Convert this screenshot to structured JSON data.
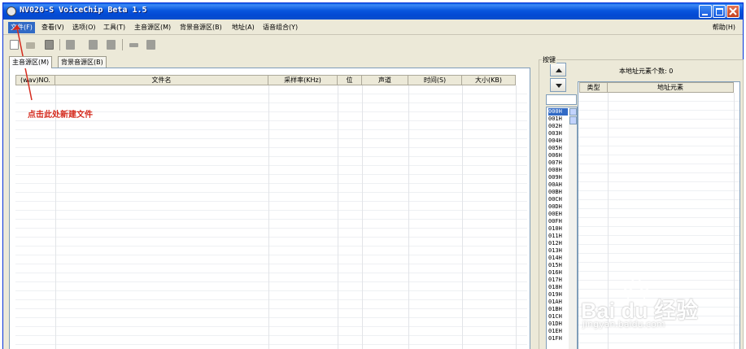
{
  "window": {
    "title": "NV020-S VoiceChip Beta 1.5"
  },
  "menu": {
    "items": [
      "文件(F)",
      "查看(V)",
      "选项(O)",
      "工具(T)",
      "主音源区(M)",
      "背景音源区(B)",
      "地址(A)",
      "语音组合(Y)"
    ],
    "help": "帮助(H)"
  },
  "toolbar": {
    "icons": [
      "new-file-icon",
      "open-folder-icon",
      "save-disk-icon",
      "tool-binoculars-icon",
      "convert-icon",
      "convert-all-icon",
      "connect-icon",
      "play-icon"
    ]
  },
  "tabs": {
    "main": "主音源区(M)",
    "background": "背景音源区(B)"
  },
  "table": {
    "headers": [
      "(wav)NO.",
      "文件名",
      "采样率(KHz)",
      "位",
      "声道",
      "时间(S)",
      "大小(KB)"
    ]
  },
  "annotation": {
    "text": "点击此处新建文件",
    "color": "#d52b1e"
  },
  "keys_panel": {
    "label": "按键",
    "count_label": "本地址元素个数: 0",
    "element_headers": [
      "类型",
      "地址元素"
    ],
    "addresses": [
      "000H",
      "001H",
      "002H",
      "003H",
      "004H",
      "005H",
      "006H",
      "007H",
      "008H",
      "009H",
      "00AH",
      "00BH",
      "00CH",
      "00DH",
      "00EH",
      "00FH",
      "010H",
      "011H",
      "012H",
      "013H",
      "014H",
      "015H",
      "016H",
      "017H",
      "018H",
      "019H",
      "01AH",
      "01BH",
      "01CH",
      "01DH",
      "01EH",
      "01FH"
    ],
    "selected": "000H"
  },
  "watermark": {
    "brand": "Bai du 经验",
    "url": "jingyan.baidu.com"
  },
  "colors": {
    "titlebar": "#0855dd",
    "menu_highlight": "#316ac5",
    "window_bg": "#ece9d8"
  }
}
